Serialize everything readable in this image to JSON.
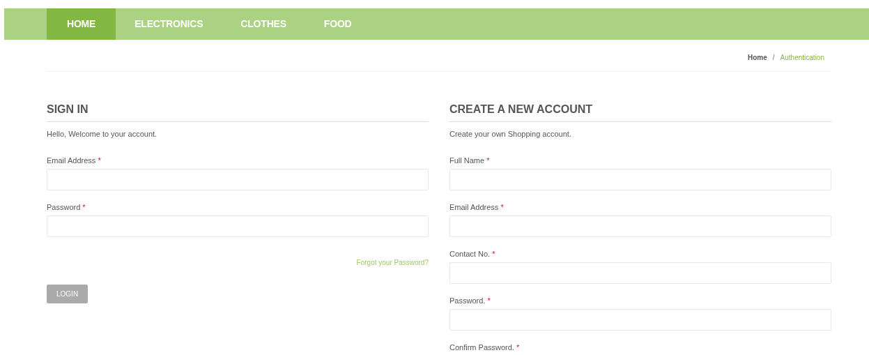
{
  "nav": [
    {
      "label": "HOME",
      "selected": true
    },
    {
      "label": "ELECTRONICS",
      "selected": false
    },
    {
      "label": "CLOTHES",
      "selected": false
    },
    {
      "label": "FOOD",
      "selected": false
    }
  ],
  "breadcrumb": [
    {
      "label": "Home",
      "selected": false
    },
    {
      "label": "Authentication",
      "selected": true
    }
  ],
  "breadcrumb_separator": "/",
  "sign_in": {
    "title": "SIGN IN",
    "intro": "Hello, Welcome to your account.",
    "fields": [
      {
        "label": "Email Address",
        "required_mark": "*",
        "has_input": true
      },
      {
        "label": "Password",
        "required_mark": "*",
        "has_input": true
      }
    ],
    "forgot_link": "Forgot your Password?",
    "button": "LOGIN"
  },
  "create_account": {
    "title": "CREATE A NEW ACCOUNT",
    "intro": "Create your own Shopping account.",
    "fields": [
      {
        "label": "Full Name",
        "required_mark": "*",
        "has_input": true
      },
      {
        "label": "Email Address",
        "required_mark": "*",
        "has_input": true
      },
      {
        "label": "Contact No.",
        "required_mark": "*",
        "has_input": true
      },
      {
        "label": "Password.",
        "required_mark": "*",
        "has_input": true
      },
      {
        "label": "Confirm Password.",
        "required_mark": "*",
        "has_input": false
      }
    ]
  }
}
